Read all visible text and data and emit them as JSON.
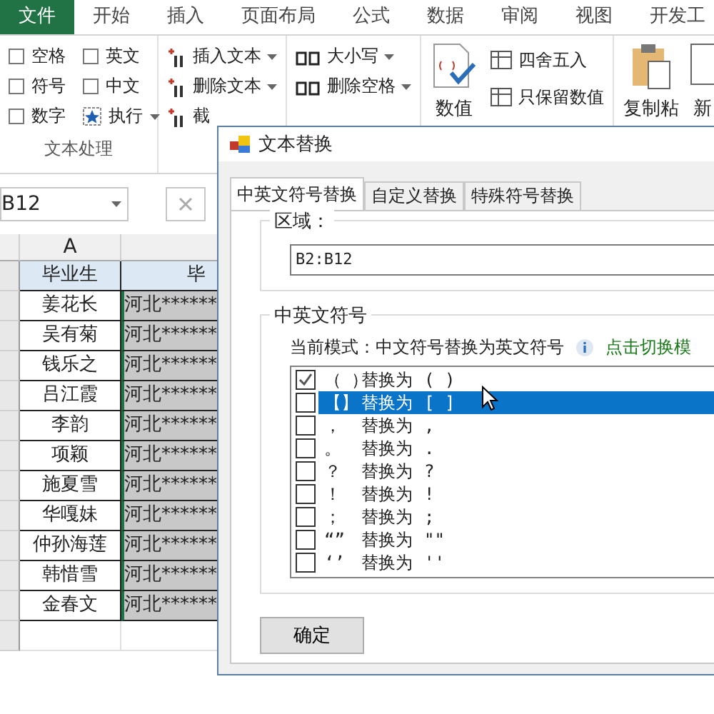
{
  "tabs": [
    {
      "label": "文件",
      "selected": true
    },
    {
      "label": "开始",
      "selected": false
    },
    {
      "label": "插入",
      "selected": false
    },
    {
      "label": "页面布局",
      "selected": false
    },
    {
      "label": "公式",
      "selected": false
    },
    {
      "label": "数据",
      "selected": false
    },
    {
      "label": "审阅",
      "selected": false
    },
    {
      "label": "视图",
      "selected": false
    },
    {
      "label": "开发工",
      "selected": false
    }
  ],
  "ribbon": {
    "options": [
      {
        "label": "空格",
        "checked": false
      },
      {
        "label": "符号",
        "checked": false
      },
      {
        "label": "数字",
        "checked": false
      },
      {
        "label": "英文",
        "checked": false
      },
      {
        "label": "中文",
        "checked": false
      }
    ],
    "run_button": "执行",
    "text_tools": [
      "插入文本",
      "删除文本",
      "截"
    ],
    "case_tools": [
      "大小写",
      "删除空格"
    ],
    "group_label": "文本处理",
    "number_button": "数值",
    "number_tools": [
      "四舍五入",
      "只保留数值"
    ],
    "paste_button": "复制粘",
    "new_button": "新"
  },
  "name_box": "B12",
  "sheet": {
    "column": "A",
    "rows": [
      [
        "毕业生",
        "毕"
      ],
      [
        "姜花长",
        "河北******"
      ],
      [
        "吴有菊",
        "河北******"
      ],
      [
        "钱乐之",
        "河北******"
      ],
      [
        "吕江霞",
        "河北******"
      ],
      [
        "李韵",
        "河北******"
      ],
      [
        "项颖",
        "河北******"
      ],
      [
        "施夏雪",
        "河北******"
      ],
      [
        "华嘎妹",
        "河北******"
      ],
      [
        "仲孙海莲",
        "河北******"
      ],
      [
        "韩惜雪",
        "河北******"
      ],
      [
        "金春文",
        "河北******"
      ]
    ]
  },
  "dialog": {
    "title": "文本替换",
    "tabs": [
      {
        "label": "中英文符号替换",
        "selected": true
      },
      {
        "label": "自定义替换",
        "selected": false
      },
      {
        "label": "特殊符号替换",
        "selected": false
      }
    ],
    "range_label": "区域：",
    "range_value": "B2:B12",
    "symbols_label": "中英文符号",
    "mode_text": "当前模式：中文符号替换为英文符号",
    "switch_link": "点击切换模",
    "items": [
      {
        "source": "（ ）",
        "action": "替换为",
        "target": "( )",
        "checked": true,
        "selected": false
      },
      {
        "source": "【】",
        "action": "替换为",
        "target": "[ ]",
        "checked": false,
        "selected": true
      },
      {
        "source": "，",
        "action": "替换为",
        "target": ",",
        "checked": false,
        "selected": false
      },
      {
        "source": "。",
        "action": "替换为",
        "target": ".",
        "checked": false,
        "selected": false
      },
      {
        "source": "？",
        "action": "替换为",
        "target": "?",
        "checked": false,
        "selected": false
      },
      {
        "source": "！",
        "action": "替换为",
        "target": "!",
        "checked": false,
        "selected": false
      },
      {
        "source": "；",
        "action": "替换为",
        "target": ";",
        "checked": false,
        "selected": false
      },
      {
        "source": "“”",
        "action": "替换为",
        "target": "\"\"",
        "checked": false,
        "selected": false
      },
      {
        "source": "‘’",
        "action": "替换为",
        "target": "''",
        "checked": false,
        "selected": false
      }
    ],
    "ok_button": "确定"
  }
}
